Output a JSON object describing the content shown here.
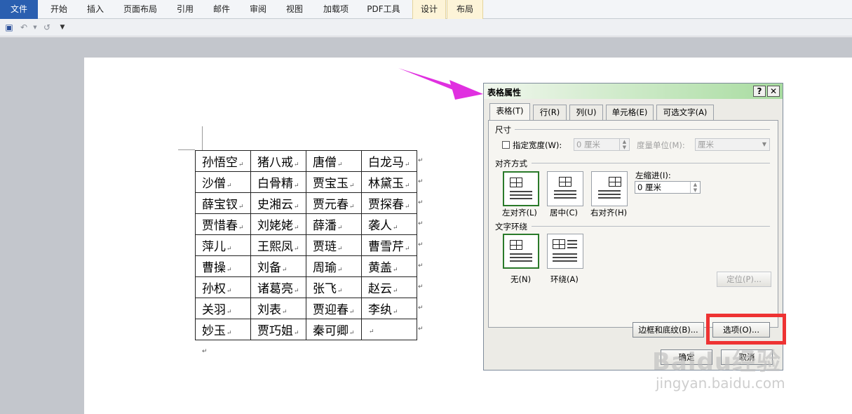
{
  "ribbon": {
    "tabs": [
      {
        "label": "文件",
        "kind": "file"
      },
      {
        "label": "开始",
        "kind": "normal"
      },
      {
        "label": "插入",
        "kind": "normal"
      },
      {
        "label": "页面布局",
        "kind": "normal"
      },
      {
        "label": "引用",
        "kind": "normal"
      },
      {
        "label": "邮件",
        "kind": "normal"
      },
      {
        "label": "审阅",
        "kind": "normal"
      },
      {
        "label": "视图",
        "kind": "normal"
      },
      {
        "label": "加载项",
        "kind": "normal"
      },
      {
        "label": "PDF工具",
        "kind": "normal"
      },
      {
        "label": "设计",
        "kind": "contextual"
      },
      {
        "label": "布局",
        "kind": "contextual"
      }
    ]
  },
  "quick_access": {
    "icons": [
      "save-icon",
      "undo-icon",
      "undo-dropdown-icon",
      "redo-icon",
      "customize-dropdown-icon"
    ]
  },
  "document": {
    "table_rows": [
      [
        "孙悟空",
        "猪八戒",
        "唐僧",
        "白龙马"
      ],
      [
        "沙僧",
        "白骨精",
        "贾宝玉",
        "林黛玉"
      ],
      [
        "薛宝钗",
        "史湘云",
        "贾元春",
        "贾探春"
      ],
      [
        "贾惜春",
        "刘姥姥",
        "薛潘",
        "袭人"
      ],
      [
        "萍儿",
        "王熙凤",
        "贾琏",
        "曹雪芹"
      ],
      [
        "曹操",
        "刘备",
        "周瑜",
        "黄盖"
      ],
      [
        "孙权",
        "诸葛亮",
        "张飞",
        "赵云"
      ],
      [
        "关羽",
        "刘表",
        "贾迎春",
        "李纨"
      ],
      [
        "妙玉",
        "贾巧姐",
        "秦可卿",
        ""
      ]
    ],
    "cell_mark": "↵",
    "paragraph_mark": "↵"
  },
  "dialog": {
    "title": "表格属性",
    "help_label": "?",
    "close_label": "✕",
    "tabs": [
      "表格(T)",
      "行(R)",
      "列(U)",
      "单元格(E)",
      "可选文字(A)"
    ],
    "active_tab": 0,
    "size_group": {
      "label": "尺寸",
      "preferred_width_label": "指定宽度(W):",
      "preferred_width_value": "0 厘米",
      "measure_label": "度量单位(M):",
      "measure_value": "厘米"
    },
    "alignment_group": {
      "label": "对齐方式",
      "options": [
        "左对齐(L)",
        "居中(C)",
        "右对齐(H)"
      ],
      "selected": 0,
      "indent_label": "左缩进(I):",
      "indent_value": "0 厘米"
    },
    "wrap_group": {
      "label": "文字环绕",
      "options": [
        "无(N)",
        "环绕(A)"
      ],
      "selected": 0,
      "position_button": "定位(P)..."
    },
    "buttons": {
      "borders": "边框和底纹(B)...",
      "options": "选项(O)...",
      "ok": "确定",
      "cancel": "取消"
    }
  },
  "colors": {
    "highlight_box": "#e33333",
    "arrow": "#e030e0",
    "selected_border": "#2a7a2a"
  },
  "watermark": {
    "brand": "Baidu经验",
    "url": "jingyan.baidu.com"
  }
}
